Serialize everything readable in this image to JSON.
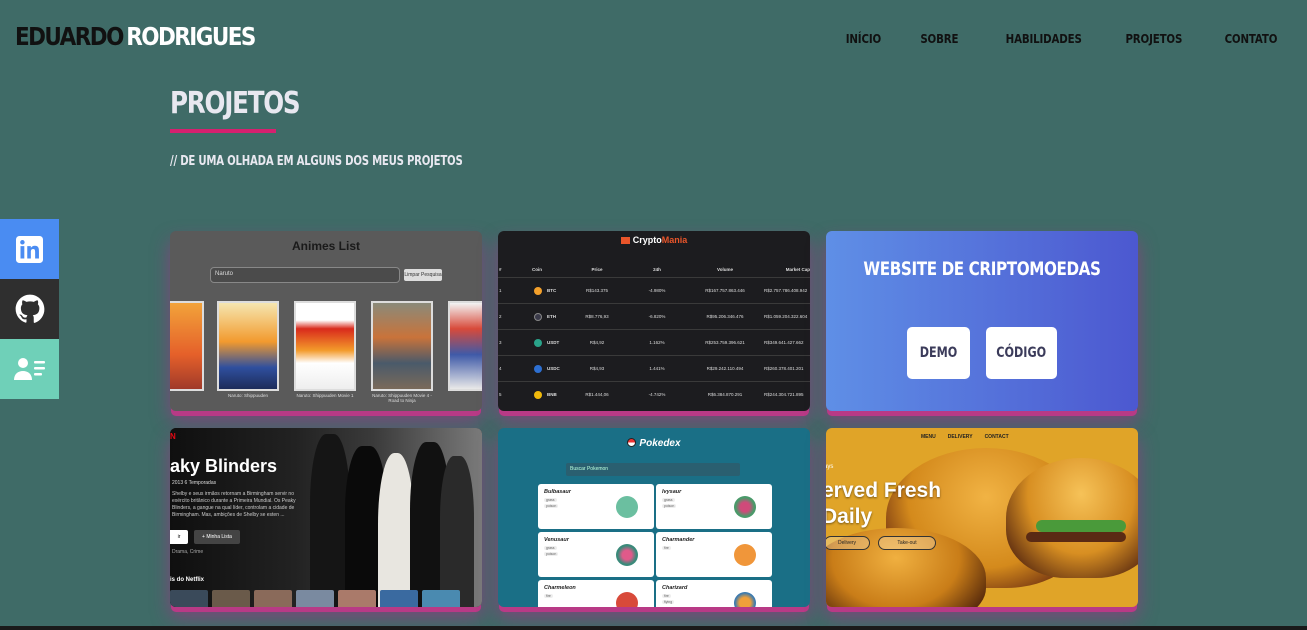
{
  "header": {
    "logo_first": "EDUARDO",
    "logo_last": "RODRIGUES",
    "nav": [
      "INÍCIO",
      "SOBRE",
      "HABILIDADES",
      "PROJETOS",
      "CONTATO"
    ]
  },
  "section": {
    "title": "PROJETOS",
    "subtitle": "// DE UMA OLHADA EM ALGUNS DOS MEUS PROJETOS"
  },
  "social": [
    "linkedin-icon",
    "github-icon",
    "contact-card-icon"
  ],
  "colors": {
    "background": "#3f6b67",
    "accent": "#d6206f",
    "linkedin": "#4a8cf2",
    "github": "#2f2f2f",
    "contact": "#6fd0b8"
  },
  "cards": {
    "anime": {
      "title": "Animes List",
      "search_placeholder": "Naruto",
      "search_button": "Limpar Pesquisa",
      "captions": [
        "",
        "Naruto: Shippuuden",
        "Naruto: Shippuuden Movie 1",
        "Naruto: Shippuuden Movie 4 - Road to Ninja",
        ""
      ]
    },
    "crypto": {
      "brand_a": "Crypto",
      "brand_b": "Mania",
      "headers": [
        "#",
        "Coin",
        "Price",
        "24h",
        "Volume",
        "Market Cap"
      ],
      "rows": [
        {
          "n": "1",
          "coin": "BTC",
          "price": "R$143.375",
          "h24": "-4.980%",
          "vol": "R$167.757.863.446",
          "cap": "R$2.757.786.408.942"
        },
        {
          "n": "2",
          "coin": "ETH",
          "price": "R$8.776,93",
          "h24": "-6.820%",
          "vol": "R$95.206.346.476",
          "cap": "R$1.059.204.322.604"
        },
        {
          "n": "3",
          "coin": "USDT",
          "price": "R$4,92",
          "h24": "1.162%",
          "vol": "R$253.759.396.621",
          "cap": "R$349.641.427.662"
        },
        {
          "n": "4",
          "coin": "USDC",
          "price": "R$4,93",
          "h24": "1.441%",
          "vol": "R$29.242.110.494",
          "cap": "R$260.378.401.201"
        },
        {
          "n": "5",
          "coin": "BNB",
          "price": "R$1.444,06",
          "h24": "-4.742%",
          "vol": "R$6.384.870.291",
          "cap": "R$244.304.721.895"
        }
      ]
    },
    "website": {
      "title": "WEBSITE DE CRIPTOMOEDAS",
      "demo_label": "DEMO",
      "code_label": "CÓDIGO"
    },
    "netflix": {
      "title": "aky Blinders",
      "meta": "2013   6 Temporadas",
      "description": "Shelby e seus irmãos retornam a Birmingham servir no exército britânico durante a Primeira Mundial. Os Peaky Blinders, a gangue na qual líder, controlam a cidade de Birmingham. Mas, ambições de Shelby se esten ...",
      "watch_label": "ir",
      "list_label": "+ Minha Lista",
      "genre": "Drama, Crime",
      "row_title": "is do Netflix"
    },
    "pokedex": {
      "title": "Pokedex",
      "search_placeholder": "Buscar Pokemon",
      "pokemon": [
        {
          "name": "Bulbasaur",
          "types": [
            "grass",
            "poison"
          ]
        },
        {
          "name": "Ivysaur",
          "types": [
            "grass",
            "poison"
          ]
        },
        {
          "name": "Venusaur",
          "types": [
            "grass",
            "poison"
          ]
        },
        {
          "name": "Charmander",
          "types": [
            "fire"
          ]
        },
        {
          "name": "Charmeleon",
          "types": [
            "fire"
          ]
        },
        {
          "name": "Charizard",
          "types": [
            "fire",
            "flying"
          ]
        }
      ]
    },
    "burger": {
      "nav": [
        "MENU",
        "DELIVERY",
        "CONTACT"
      ],
      "small": "ays",
      "headline_1": "erved Fresh",
      "headline_2": "Daily",
      "btn_delivery": "Delivery",
      "btn_takeout": "Take-out"
    }
  }
}
